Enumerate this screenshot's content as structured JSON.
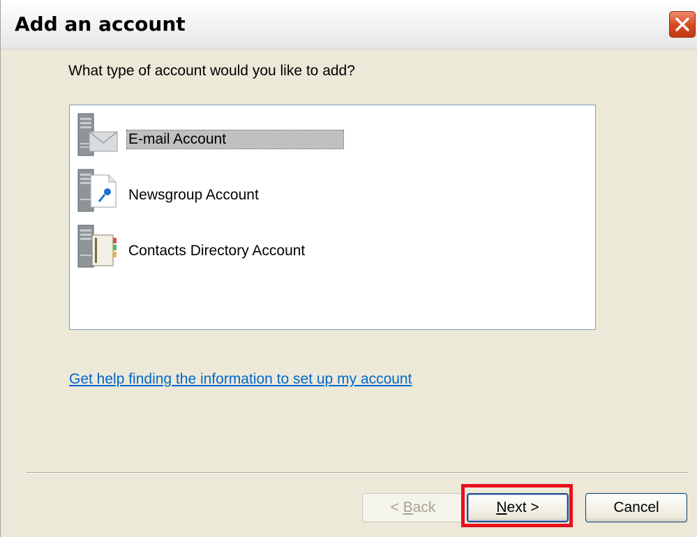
{
  "window": {
    "title": "Add an account"
  },
  "dialog": {
    "prompt": "What type of account would you like to add?",
    "accounts": [
      {
        "label": "E-mail Account",
        "icon": "email-server-icon",
        "selected": true
      },
      {
        "label": "Newsgroup Account",
        "icon": "newsgroup-server-icon",
        "selected": false
      },
      {
        "label": "Contacts Directory Account",
        "icon": "contacts-directory-server-icon",
        "selected": false
      }
    ],
    "help_link": "Get help finding the information to set up my account"
  },
  "buttons": {
    "back": {
      "prefix": "< ",
      "accel": "B",
      "rest": "ack",
      "enabled": false
    },
    "next": {
      "accel": "N",
      "rest": "ext >",
      "enabled": true
    },
    "cancel": {
      "label": "Cancel"
    }
  },
  "colors": {
    "highlight_box": "#e8101c",
    "link": "#0066cc",
    "close_button": "#d4481f"
  }
}
